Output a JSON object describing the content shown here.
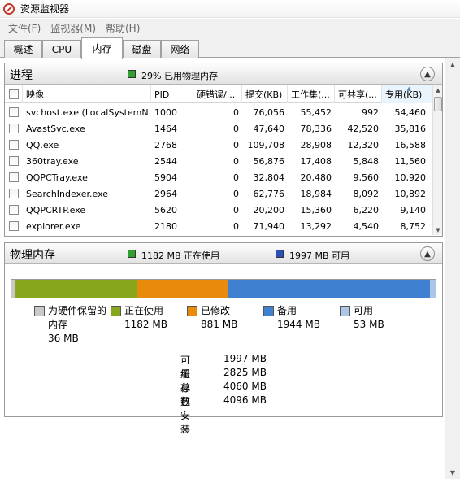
{
  "window": {
    "title": "资源监视器"
  },
  "menu": [
    "文件(F)",
    "监视器(M)",
    "帮助(H)"
  ],
  "tabs": [
    "概述",
    "CPU",
    "内存",
    "磁盘",
    "网络"
  ],
  "active_tab": "内存",
  "processes": {
    "title": "进程",
    "usage_text": "29% 已用物理内存",
    "columns": [
      "映像",
      "PID",
      "硬错误/...",
      "提交(KB)",
      "工作集(...",
      "可共享(...",
      "专用(KB)"
    ],
    "sorted_column": "专用(KB)",
    "rows": [
      {
        "image": "svchost.exe (LocalSystemN...",
        "pid": "1000",
        "hard_faults": "0",
        "commit": "76,056",
        "working_set": "55,452",
        "shareable": "992",
        "private": "54,460"
      },
      {
        "image": "AvastSvc.exe",
        "pid": "1464",
        "hard_faults": "0",
        "commit": "47,640",
        "working_set": "78,336",
        "shareable": "42,520",
        "private": "35,816"
      },
      {
        "image": "QQ.exe",
        "pid": "2768",
        "hard_faults": "0",
        "commit": "109,708",
        "working_set": "28,908",
        "shareable": "12,320",
        "private": "16,588"
      },
      {
        "image": "360tray.exe",
        "pid": "2544",
        "hard_faults": "0",
        "commit": "56,876",
        "working_set": "17,408",
        "shareable": "5,848",
        "private": "11,560"
      },
      {
        "image": "QQPCTray.exe",
        "pid": "5904",
        "hard_faults": "0",
        "commit": "32,804",
        "working_set": "20,480",
        "shareable": "9,560",
        "private": "10,920"
      },
      {
        "image": "SearchIndexer.exe",
        "pid": "2964",
        "hard_faults": "0",
        "commit": "62,776",
        "working_set": "18,984",
        "shareable": "8,092",
        "private": "10,892"
      },
      {
        "image": "QQPCRTP.exe",
        "pid": "5620",
        "hard_faults": "0",
        "commit": "20,200",
        "working_set": "15,360",
        "shareable": "6,220",
        "private": "9,140"
      },
      {
        "image": "explorer.exe",
        "pid": "2180",
        "hard_faults": "0",
        "commit": "71,940",
        "working_set": "13,292",
        "shareable": "4,540",
        "private": "8,752"
      }
    ]
  },
  "physical_memory": {
    "title": "物理内存",
    "in_use_text": "1182 MB 正在使用",
    "available_text": "1997 MB 可用",
    "bar": [
      {
        "name": "hardware-reserved",
        "mb": 36,
        "color": "#c9c9c9"
      },
      {
        "name": "in-use",
        "mb": 1182,
        "color": "#88a61b"
      },
      {
        "name": "modified",
        "mb": 881,
        "color": "#e88a0b"
      },
      {
        "name": "standby",
        "mb": 1944,
        "color": "#4080d0"
      },
      {
        "name": "free",
        "mb": 53,
        "color": "#aec6e6"
      }
    ],
    "legend": {
      "hardware_reserved": {
        "label": "为硬件保留的",
        "label2": "内存",
        "value": "36 MB",
        "color": "#c9c9c9"
      },
      "in_use": {
        "label": "正在使用",
        "value": "1182 MB",
        "color": "#88a61b"
      },
      "modified": {
        "label": "已修改",
        "value": "881 MB",
        "color": "#e88a0b"
      },
      "standby": {
        "label": "备用",
        "value": "1944 MB",
        "color": "#4080d0"
      },
      "free": {
        "label": "可用",
        "value": "53 MB",
        "color": "#aec6e6"
      }
    },
    "summary": [
      {
        "label": "可用",
        "value": "1997 MB"
      },
      {
        "label": "缓存",
        "value": "2825 MB"
      },
      {
        "label": "总数",
        "value": "4060 MB"
      },
      {
        "label": "已安装",
        "value": "4096 MB"
      }
    ]
  },
  "colors": {
    "in_use_indicator": "#2f9f2f",
    "available_indicator": "#2b4fb7"
  }
}
